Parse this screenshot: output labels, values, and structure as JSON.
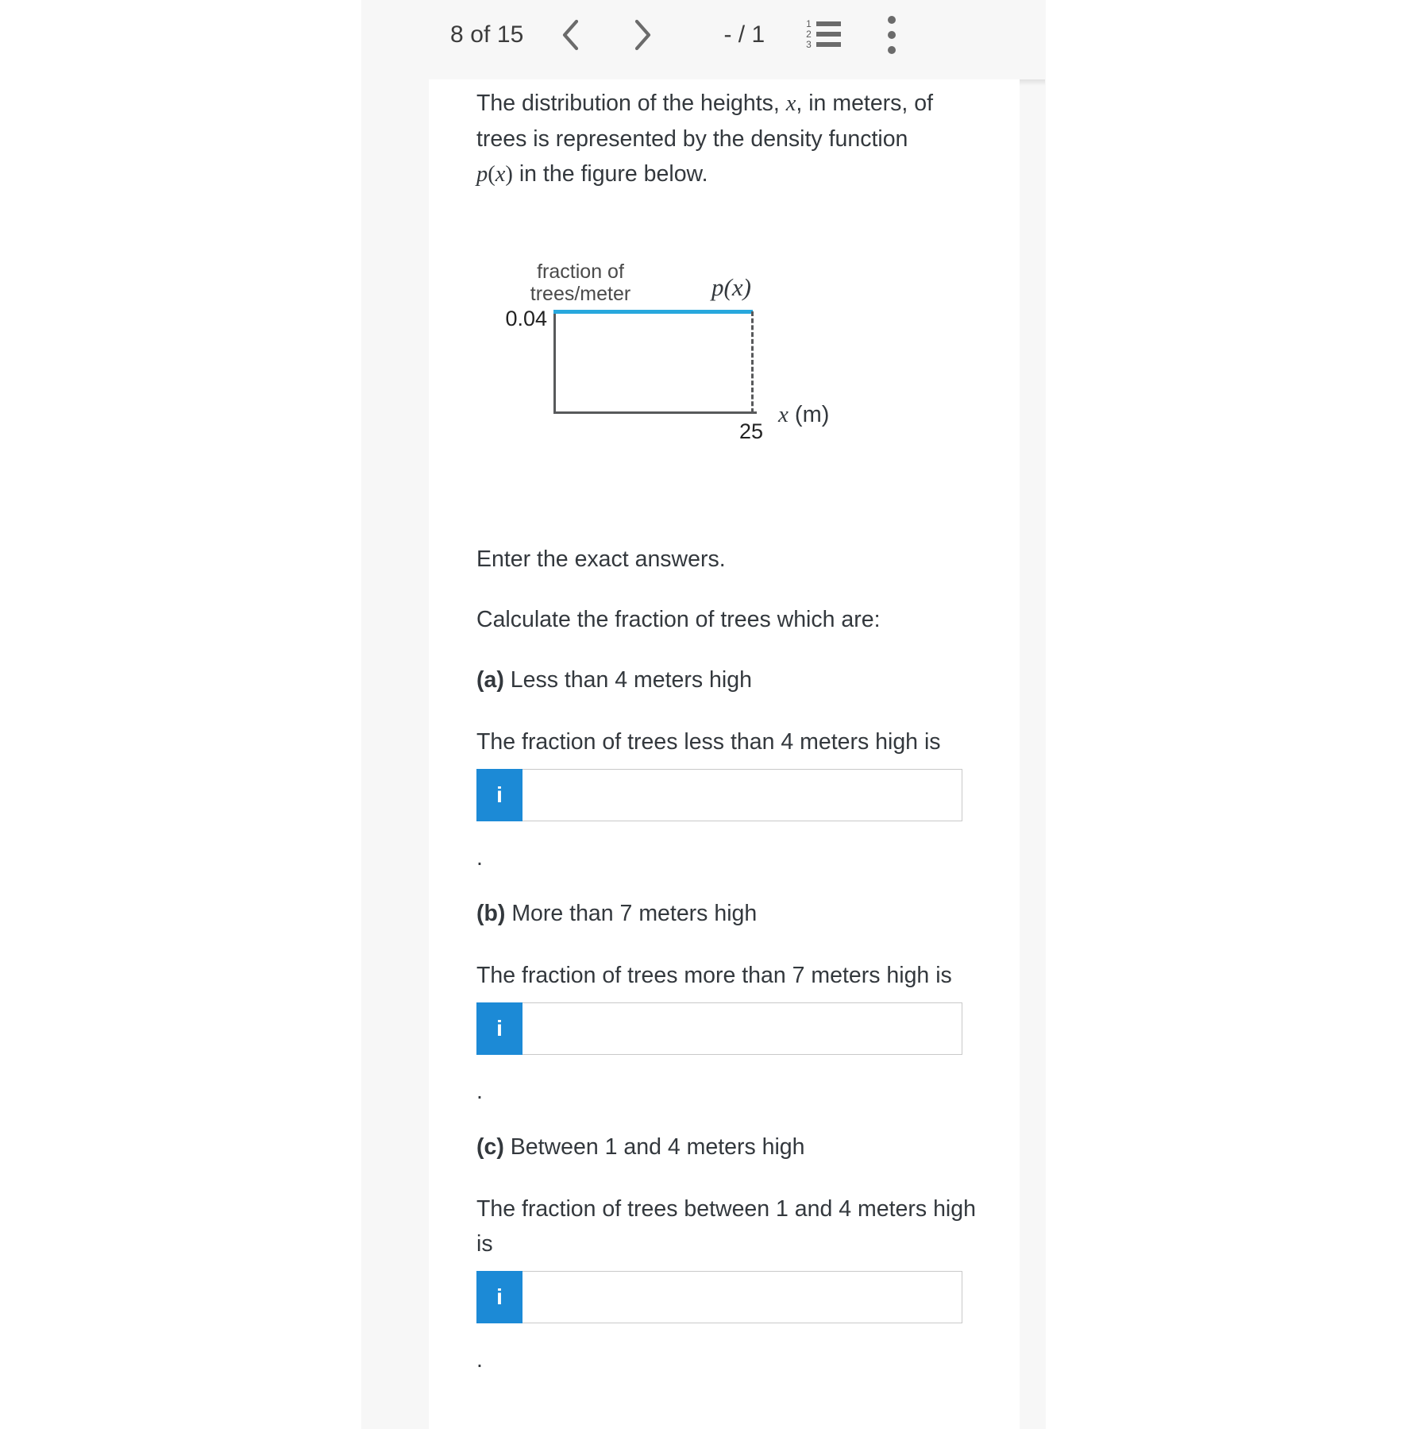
{
  "toolbar": {
    "page_count": "8 of 15",
    "prev_label": "‹",
    "next_label": "›",
    "score": "- / 1",
    "list_icon_digits": [
      "1",
      "2",
      "3"
    ],
    "list_icon_name": "numbered-list-icon",
    "menu_icon_name": "more-options-icon"
  },
  "question": {
    "intro_line1_a": "The distribution of the heights, ",
    "intro_line1_var": "x",
    "intro_line1_b": ", in meters, of",
    "intro_line2": "trees is represented by the density function",
    "intro_line3_fn": "p",
    "intro_line3_open": "(",
    "intro_line3_var": "x",
    "intro_line3_close": ")",
    "intro_line3_rest": " in the figure below.",
    "exact_answers": "Enter the exact answers.",
    "calculate": "Calculate the fraction of trees which are:",
    "period": "."
  },
  "figure": {
    "y_axis_label": "fraction of trees/meter",
    "y_axis_label_line1": "fraction of",
    "y_axis_label_line2": "trees/meter",
    "curve_label_fn": "p",
    "curve_label_open": "(",
    "curve_label_var": "x",
    "curve_label_close": ")",
    "y_tick": "0.04",
    "x_tick": "25",
    "x_axis_var": "x",
    "x_axis_unit": " (m)",
    "line_color": "#28a8dd",
    "axis_color": "#58595b"
  },
  "chart_data": {
    "type": "area",
    "title": "",
    "xlabel": "x (m)",
    "ylabel": "fraction of trees/meter",
    "series_label": "p(x)",
    "x": [
      0,
      25
    ],
    "values": [
      0.04,
      0.04
    ],
    "xlim": [
      0,
      27
    ],
    "ylim": [
      0,
      0.052
    ],
    "xticks": [
      25
    ],
    "xticklabels": [
      "25"
    ],
    "yticks": [
      0.04
    ],
    "yticklabels": [
      "0.04"
    ],
    "grid": false,
    "legend": "none",
    "annotations": [
      {
        "text": "p(x)",
        "x": 22,
        "y": 0.048
      },
      {
        "text": "dashed drop line at x = 25",
        "x": 25,
        "y": 0.02
      }
    ],
    "description": "Uniform probability density: p(x) = 0.04 constant on 0 ≤ x ≤ 25, zero elsewhere."
  },
  "parts": [
    {
      "id": "a",
      "label": "(a)",
      "title": "Less than 4 meters high",
      "prompt": "The fraction of trees less than 4 meters high is",
      "info_label": "i",
      "input_value": "",
      "input_placeholder": "",
      "trailing": "."
    },
    {
      "id": "b",
      "label": "(b)",
      "title": "More than 7 meters high",
      "prompt": "The fraction of trees more than 7 meters high is",
      "info_label": "i",
      "input_value": "",
      "input_placeholder": "",
      "trailing": "."
    },
    {
      "id": "c",
      "label": "(c)",
      "title": "Between 1 and 4 meters high",
      "prompt": "The fraction of trees between 1 and 4 meters high is",
      "info_label": "i",
      "input_value": "",
      "input_placeholder": "",
      "trailing": "."
    }
  ],
  "colors": {
    "accent_blue": "#1c8ad6",
    "curve_blue": "#28a8dd",
    "text": "#33383d",
    "toolbar_bg": "#f7f7f7",
    "gutter_bg": "#f7f7f7"
  }
}
